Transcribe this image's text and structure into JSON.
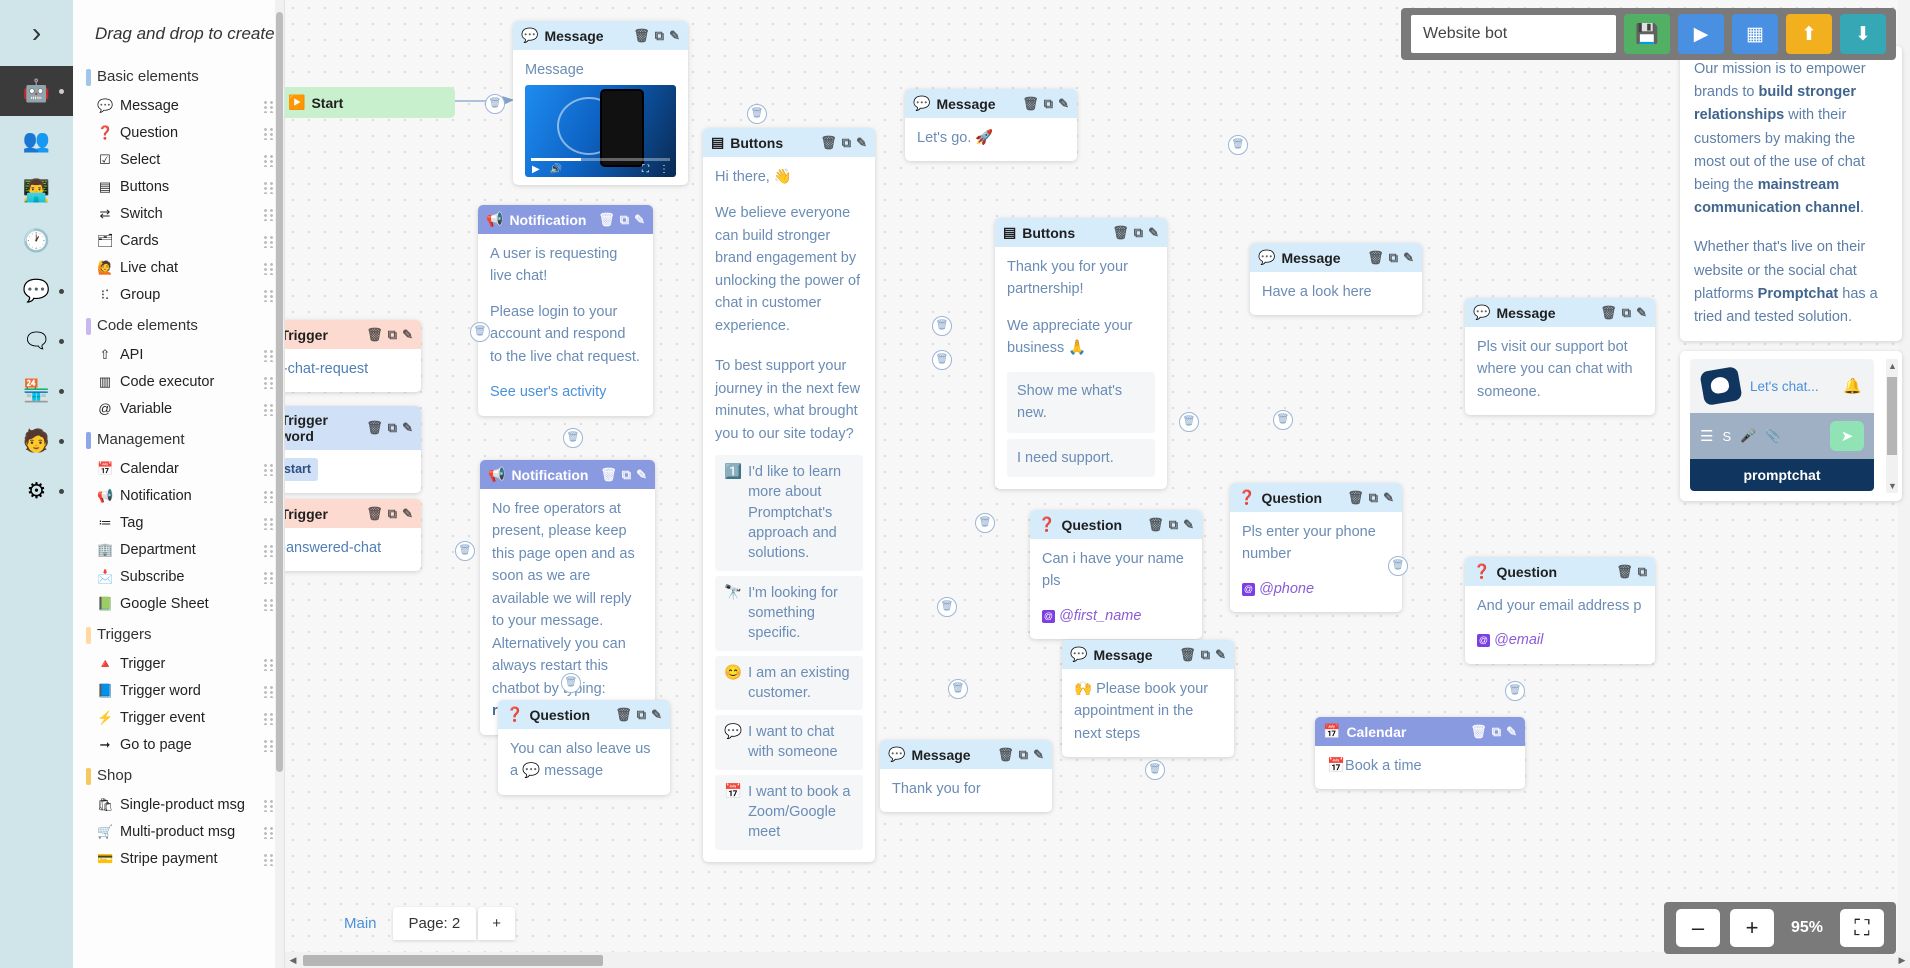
{
  "rail": {
    "collapse_icon": "›",
    "items": [
      {
        "name": "bot",
        "icon": "🤖",
        "active": true,
        "dot": true
      },
      {
        "name": "contacts",
        "icon": "👥",
        "active": false,
        "dot": false
      },
      {
        "name": "team",
        "icon": "👨‍💻",
        "active": false,
        "dot": false
      },
      {
        "name": "schedule",
        "icon": "🕐",
        "active": false,
        "dot": false
      },
      {
        "name": "chat",
        "icon": "💬",
        "active": false,
        "dot": true
      },
      {
        "name": "qa",
        "icon": "🗨",
        "active": false,
        "dot": true
      },
      {
        "name": "shop",
        "icon": "🏪",
        "active": false,
        "dot": true
      },
      {
        "name": "profile",
        "icon": "🧑",
        "active": false,
        "dot": true
      },
      {
        "name": "settings",
        "icon": "⚙",
        "active": false,
        "dot": true
      }
    ]
  },
  "palette": {
    "title": "Drag and drop to create",
    "groups": [
      {
        "label": "Basic elements",
        "style": "g-basic",
        "items": [
          {
            "label": "Message",
            "icon": "💬"
          },
          {
            "label": "Question",
            "icon": "❓"
          },
          {
            "label": "Select",
            "icon": "☑"
          },
          {
            "label": "Buttons",
            "icon": "▤"
          },
          {
            "label": "Switch",
            "icon": "⇄"
          },
          {
            "label": "Cards",
            "icon": "🗂"
          },
          {
            "label": "Live chat",
            "icon": "🙋"
          },
          {
            "label": "Group",
            "icon": "⁝⁚"
          }
        ]
      },
      {
        "label": "Code elements",
        "style": "g-code",
        "items": [
          {
            "label": "API",
            "icon": "⇧"
          },
          {
            "label": "Code executor",
            "icon": "▥"
          },
          {
            "label": "Variable",
            "icon": "@"
          }
        ]
      },
      {
        "label": "Management",
        "style": "g-mgmt",
        "items": [
          {
            "label": "Calendar",
            "icon": "📅"
          },
          {
            "label": "Notification",
            "icon": "📢"
          },
          {
            "label": "Tag",
            "icon": "≔"
          },
          {
            "label": "Department",
            "icon": "🏢"
          },
          {
            "label": "Subscribe",
            "icon": "📩"
          },
          {
            "label": "Google Sheet",
            "icon": "📗"
          }
        ]
      },
      {
        "label": "Triggers",
        "style": "g-trig",
        "items": [
          {
            "label": "Trigger",
            "icon": "🔺"
          },
          {
            "label": "Trigger word",
            "icon": "📘"
          },
          {
            "label": "Trigger event",
            "icon": "⚡"
          },
          {
            "label": "Go to page",
            "icon": "➞"
          }
        ]
      },
      {
        "label": "Shop",
        "style": "g-shop",
        "items": [
          {
            "label": "Single-product msg",
            "icon": "🛍"
          },
          {
            "label": "Multi-product msg",
            "icon": "🛒"
          },
          {
            "label": "Stripe payment",
            "icon": "💳"
          }
        ]
      }
    ]
  },
  "toolbar": {
    "bot_name": "Website bot",
    "bot_name_placeholder": "Bot name",
    "buttons": [
      {
        "name": "save-button",
        "icon": "💾",
        "color": "#52b065"
      },
      {
        "name": "run-button",
        "icon": "▶",
        "color": "#4a90e2"
      },
      {
        "name": "table-button",
        "icon": "▦",
        "color": "#4a90e2"
      },
      {
        "name": "upload-button",
        "icon": "⬆",
        "color": "#f2b01e"
      },
      {
        "name": "download-button",
        "icon": "⬇",
        "color": "#35a7b5"
      }
    ]
  },
  "nodes": {
    "start": {
      "title": "Start",
      "icon": "▶"
    },
    "message_video": {
      "title": "Message",
      "icon": "💬",
      "body": "Message"
    },
    "notification_livechat": {
      "title": "Notification",
      "icon": "📢",
      "line1": "A user is requesting live chat!",
      "line2": "Please login to your account and respond to the live chat request.",
      "link": "See user's activity"
    },
    "trigger_livechat": {
      "title": "Trigger",
      "icon": "🔺",
      "value": "live-chat-request"
    },
    "trigger_word_restart": {
      "title": "Trigger word",
      "icon": "📘",
      "chip": "Restart"
    },
    "trigger_notanswered": {
      "title": "Trigger",
      "icon": "🔺",
      "value": "not-answered-chat"
    },
    "notification_nooperators": {
      "title": "Notification",
      "icon": "📢",
      "text_a": "No free operators at present, please keep this page open and as soon as we are available we will reply to your message. Alternatively you can always restart this chatbot by typing: ",
      "text_b": "restart"
    },
    "buttons_hithere": {
      "title": "Buttons",
      "icon": "▤",
      "p1": "Hi there, 👋",
      "p2": "We believe everyone can build stronger brand engagement by unlocking the power of chat in customer experience.",
      "p3": "To best support your journey in the next few minutes, what brought you to our site today?",
      "choices": [
        {
          "icon": "1️⃣",
          "label": "I'd like to learn more about Promptchat's approach and solutions."
        },
        {
          "icon": "🔭",
          "label": "I'm looking for something specific."
        },
        {
          "icon": "😊",
          "label": "I am an existing customer."
        },
        {
          "icon": "💬",
          "label": "I want to chat with someone"
        },
        {
          "icon": "📅",
          "label": "I want to book a Zoom/Google meet"
        }
      ]
    },
    "message_letsgo": {
      "title": "Message",
      "icon": "💬",
      "body": "Let's go. 🚀"
    },
    "buttons_thankyou": {
      "title": "Buttons",
      "icon": "▤",
      "p1": "Thank you for your partnership!",
      "p2": "We appreciate your business 🙏",
      "choices": [
        "Show me what's new.",
        "I need support."
      ]
    },
    "message_havealook": {
      "title": "Message",
      "icon": "💬",
      "body": "Have a look here"
    },
    "message_supportbot": {
      "title": "Message",
      "icon": "💬",
      "body": "Pls visit our support bot where you can chat with someone."
    },
    "question_name": {
      "title": "Question",
      "icon": "❓",
      "body": "Can i have your name pls",
      "variable": "@first_name"
    },
    "question_phone": {
      "title": "Question",
      "icon": "❓",
      "body": "Pls enter your phone number",
      "variable": "@phone"
    },
    "question_email": {
      "title": "Question",
      "icon": "❓",
      "body": "And your email address p",
      "variable": "@email"
    },
    "message_book": {
      "title": "Message",
      "icon": "💬",
      "body": "🙌 Please book your appointment in the next steps"
    },
    "calendar_book": {
      "title": "Calendar",
      "icon": "📅",
      "body": "📅Book a time"
    },
    "question_leavemsg": {
      "title": "Question",
      "icon": "❓",
      "body": "You can also leave us a 💬 message"
    },
    "message_bottom": {
      "title": "Message",
      "icon": "💬",
      "body": "Thank you for "
    }
  },
  "preview": {
    "mission": {
      "p1_a": "Our mission is to empower brands to ",
      "p1_b": "build stronger relationships",
      "p1_c": " with their customers by making the most out of the use of chat being the ",
      "p1_d": "mainstream communication channel",
      "p1_e": ".",
      "p2_a": "Whether that's live on their website or the social chat platforms ",
      "p2_b": "Promptchat",
      "p2_c": " has a tried and tested solution."
    },
    "widget": {
      "title": "Let's chat...",
      "bell_icon": "🔔",
      "menu_icon": "☰",
      "sticker_icon": "S",
      "mic_icon": "🎤",
      "attach_icon": "📎",
      "send_icon": "➤",
      "footer": "promptchat"
    }
  },
  "pages": {
    "main_label": "Main",
    "tab_label": "Page: 2",
    "add_label": "+"
  },
  "zoom": {
    "minus": "–",
    "plus": "+",
    "level": "95%",
    "fullscreen_icon": "⛶"
  }
}
